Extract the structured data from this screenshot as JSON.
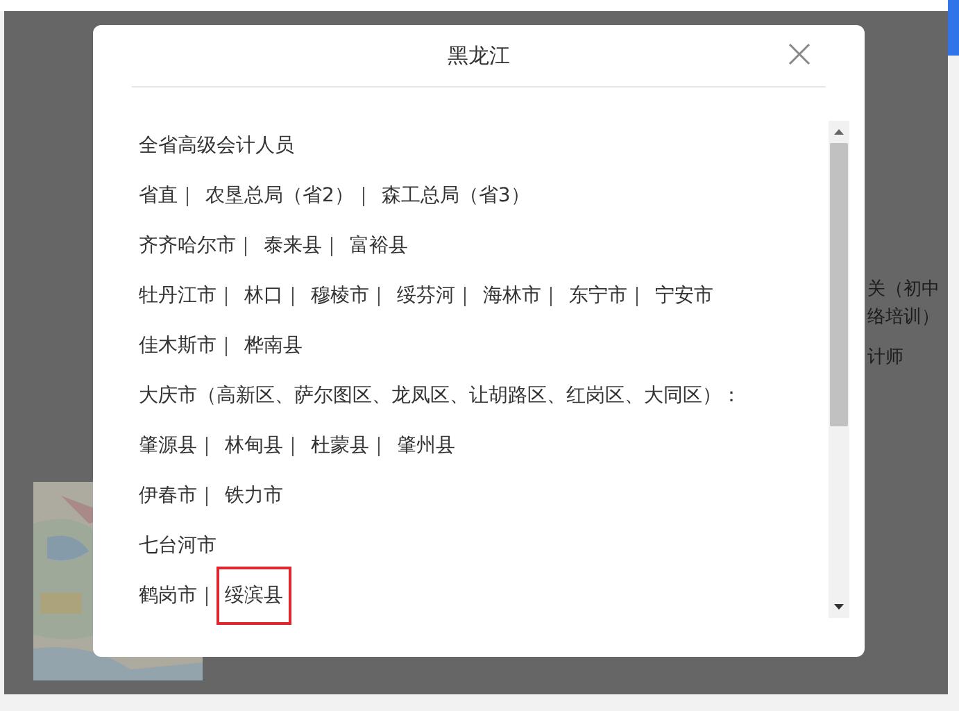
{
  "background_texts": [
    "关（初中",
    "络培训）",
    "计师"
  ],
  "dialog": {
    "title": "黑龙江",
    "lines": [
      {
        "items": [
          {
            "text": "全省高级会计人员",
            "highlighted": false
          }
        ]
      },
      {
        "items": [
          {
            "text": "省直｜",
            "highlighted": false
          },
          {
            "text": "农垦总局（省2）｜",
            "highlighted": false
          },
          {
            "text": "森工总局（省3）",
            "highlighted": false
          }
        ]
      },
      {
        "items": [
          {
            "text": "齐齐哈尔市｜",
            "highlighted": false
          },
          {
            "text": "泰来县｜",
            "highlighted": false
          },
          {
            "text": "富裕县",
            "highlighted": false
          }
        ]
      },
      {
        "items": [
          {
            "text": "牡丹江市｜",
            "highlighted": false
          },
          {
            "text": "林口｜",
            "highlighted": false
          },
          {
            "text": "穆棱市｜",
            "highlighted": false
          },
          {
            "text": "绥芬河｜",
            "highlighted": false
          },
          {
            "text": "海林市｜",
            "highlighted": false
          },
          {
            "text": "东宁市｜",
            "highlighted": false
          },
          {
            "text": "宁安市",
            "highlighted": false
          }
        ]
      },
      {
        "items": [
          {
            "text": "佳木斯市｜",
            "highlighted": false
          },
          {
            "text": "桦南县",
            "highlighted": false
          }
        ]
      },
      {
        "items": [
          {
            "text": "大庆市（高新区、萨尔图区、龙凤区、让胡路区、红岗区、大同区）：",
            "highlighted": false
          }
        ]
      },
      {
        "items": [
          {
            "text": "肇源县｜",
            "highlighted": false
          },
          {
            "text": "林甸县｜",
            "highlighted": false
          },
          {
            "text": "杜蒙县｜",
            "highlighted": false
          },
          {
            "text": "肇州县",
            "highlighted": false
          }
        ]
      },
      {
        "items": [
          {
            "text": "伊春市｜",
            "highlighted": false
          },
          {
            "text": "铁力市",
            "highlighted": false
          }
        ]
      },
      {
        "items": [
          {
            "text": "七台河市",
            "highlighted": false
          }
        ]
      },
      {
        "items": [
          {
            "text": "鹤岗市｜",
            "highlighted": false
          },
          {
            "text": "绥滨县",
            "highlighted": true
          }
        ]
      }
    ]
  }
}
